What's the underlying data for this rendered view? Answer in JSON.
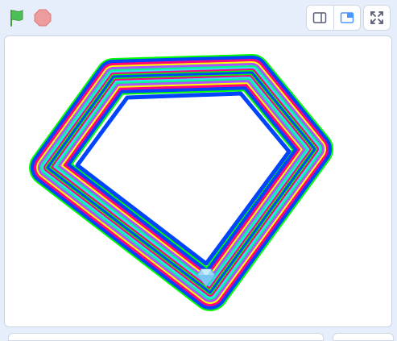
{
  "toolbar": {
    "green_flag": {
      "icon": "green-flag-icon",
      "color": "#4cbf56"
    },
    "stop": {
      "icon": "stop-icon",
      "color": "#ec9c9c"
    },
    "stage_modes": [
      {
        "icon": "small-stage-icon",
        "selected": false
      },
      {
        "icon": "normal-stage-icon",
        "selected": true,
        "accent": "#4c97ff"
      }
    ],
    "fullscreen": {
      "icon": "fullscreen-icon"
    }
  },
  "stage": {
    "background": "#ffffff",
    "drawing": {
      "shape": "diamond-outline",
      "stripe_colors": [
        "#00ff00",
        "#0055ff",
        "#ff00aa",
        "#ffff00",
        "#aa55ff",
        "#00ff99"
      ]
    },
    "sprite": {
      "icon": "diamond-sprite-icon",
      "color": "#7cc6f5"
    }
  }
}
